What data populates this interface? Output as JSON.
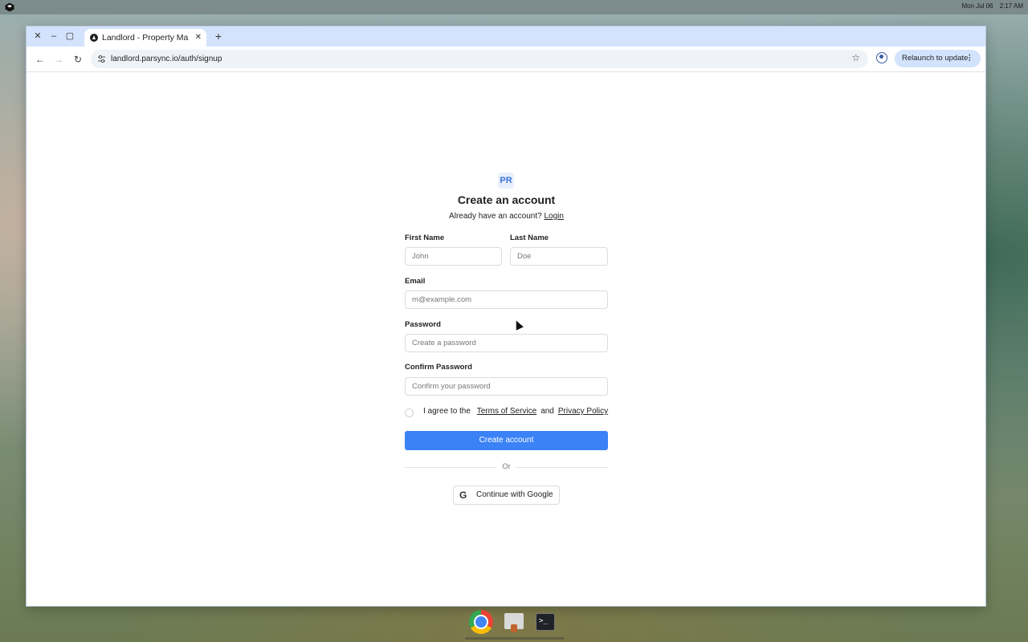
{
  "system": {
    "date": "Mon Jul 06",
    "time": "2:17 AM"
  },
  "browser": {
    "tab_title": "Landlord - Property Ma",
    "url": "landlord.parsync.io/auth/signup",
    "relaunch_label": "Relaunch to update",
    "new_tab_symbol": "+",
    "tab_close_symbol": "✕"
  },
  "signup": {
    "brand_mark": "PR",
    "title": "Create an account",
    "have_account_text": "Already have an account?",
    "login_link": "Login",
    "first_name_label": "First Name",
    "first_name_placeholder": "John",
    "last_name_label": "Last Name",
    "last_name_placeholder": "Doe",
    "email_label": "Email",
    "email_placeholder": "m@example.com",
    "password_label": "Password",
    "password_placeholder": "Create a password",
    "confirm_label": "Confirm Password",
    "confirm_placeholder": "Confirm your password",
    "agree_prefix": "I agree to the",
    "terms_link": "Terms of Service",
    "agree_and": "and",
    "privacy_link": "Privacy Policy",
    "submit_label": "Create account",
    "divider_text": "Or",
    "google_label": "Continue with Google"
  },
  "dock": {
    "terminal_glyph": ">_"
  },
  "colors": {
    "primary": "#3b82f6",
    "tabstrip": "#d3e3fd"
  }
}
